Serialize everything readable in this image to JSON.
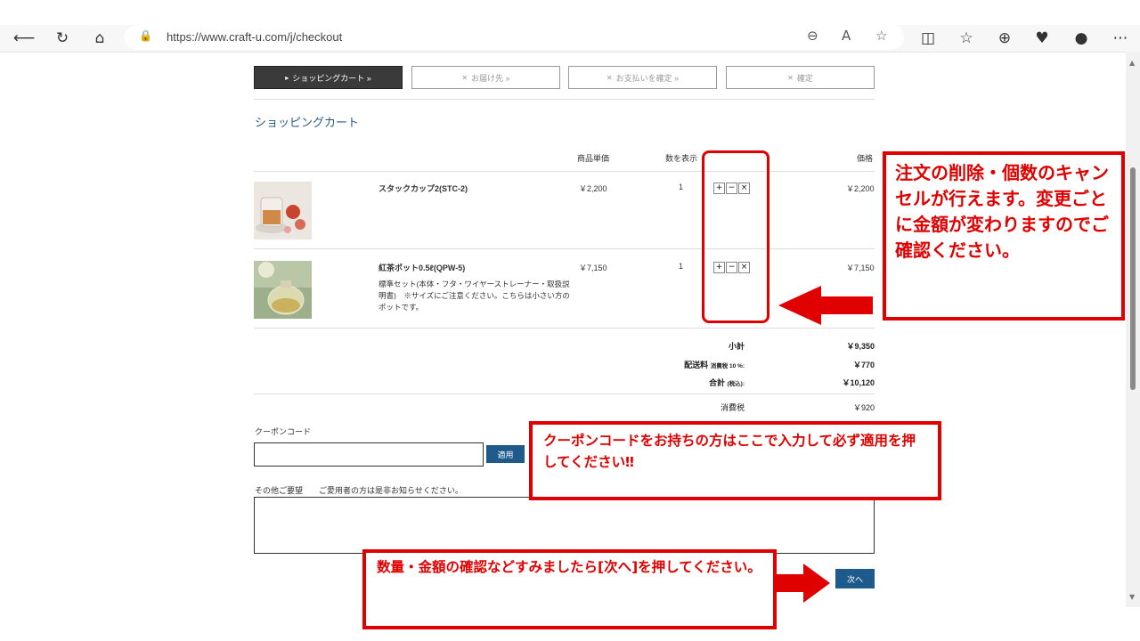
{
  "browser": {
    "url": "https://www.craft-u.com/j/checkout"
  },
  "steps": [
    {
      "mark": "▸",
      "label": "ショッピングカート »"
    },
    {
      "mark": "✕",
      "label": "お届け先 »"
    },
    {
      "mark": "✕",
      "label": "お支払いを確定 »"
    },
    {
      "mark": "✕",
      "label": "確定"
    }
  ],
  "cart": {
    "title": "ショッピングカート",
    "headers": {
      "unit_price": "商品単価",
      "quantity": "数を表示",
      "price": "価格"
    },
    "items": [
      {
        "name": "スタックカップ2(STC-2)",
        "desc": "",
        "unit_price": "￥2,200",
        "qty": "1",
        "price": "￥2,200"
      },
      {
        "name": "紅茶ポット0.5ℓ(QPW-5)",
        "desc": "標準セット(本体・フタ・ワイヤーストレーナー・取扱説明書)　※サイズにご注意ください。こちらは小さい方のポットです。",
        "unit_price": "￥7,150",
        "qty": "1",
        "price": "￥7,150"
      }
    ],
    "qty_controls": {
      "plus": "+",
      "minus": "−",
      "remove": "×"
    },
    "summary": {
      "subtotal_label": "小計",
      "subtotal": "￥9,350",
      "shipping_label": "配送料",
      "shipping_tax_note": "消費税 10 %:",
      "shipping": "￥770",
      "total_label": "合計",
      "total_note": "(税込):",
      "total": "￥10,120",
      "tax_label": "消費税",
      "tax": "￥920"
    }
  },
  "coupon": {
    "label": "クーポンコード",
    "value": "",
    "apply_label": "適用"
  },
  "remarks": {
    "label": "その他ご要望　　ご愛用者の方は是非お知らせください。",
    "value": ""
  },
  "next_label": "次へ",
  "annotations": {
    "note1": "注文の削除・個数のキャンセルが行えます。変更ごとに金額が変わりますのでご確認ください。",
    "note2": "クーポンコードをお持ちの方はここで入力して必ず適用を押してください‼",
    "note3": "数量・金額の確認などすみましたら[次へ]を押してください。",
    "color": "#e00000"
  }
}
